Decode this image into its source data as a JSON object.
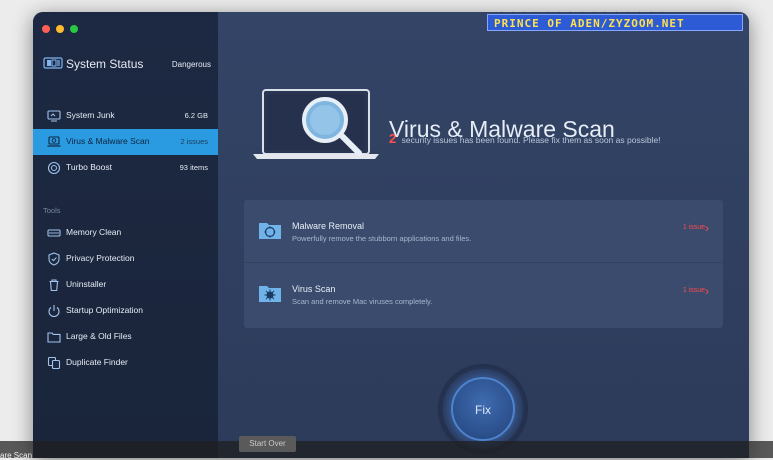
{
  "sidebar": {
    "status_title": "System Status",
    "status_value": "Dangerous",
    "items": [
      {
        "label": "System Junk",
        "value": "6.2 GB"
      },
      {
        "label": "Virus & Malware Scan",
        "value": "2 issues"
      },
      {
        "label": "Turbo Boost",
        "value": "93 items"
      }
    ],
    "tools_title": "Tools",
    "tools": [
      {
        "label": "Memory Clean"
      },
      {
        "label": "Privacy Protection"
      },
      {
        "label": "Uninstaller"
      },
      {
        "label": "Startup Optimization"
      },
      {
        "label": "Large & Old Files"
      },
      {
        "label": "Duplicate Finder"
      }
    ]
  },
  "main": {
    "title": "Virus & Malware Scan",
    "issue_count": "2",
    "subtitle": "security issues has been found. Please fix them as soon as possible!",
    "rows": [
      {
        "title": "Malware Removal",
        "desc": "Powerfully remove the stubborn applications and files.",
        "issue": "1 issue"
      },
      {
        "title": "Virus Scan",
        "desc": "Scan and remove Mac viruses completely.",
        "issue": "1 issue"
      }
    ],
    "fix_label": "Fix",
    "start_over": "Start Over"
  },
  "bottom_caption": "are Scan",
  "watermark": "PRINCE OF ADEN/ZYZOOM.NET",
  "colors": {
    "accent": "#2a9be0",
    "danger": "#ff4a4a"
  }
}
